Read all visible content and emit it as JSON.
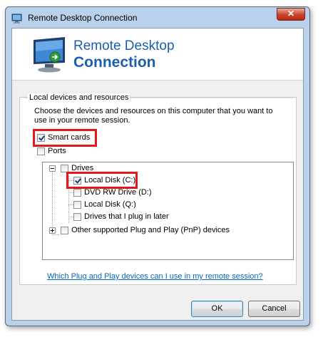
{
  "window": {
    "title": "Remote Desktop Connection",
    "close_label": "✕"
  },
  "banner": {
    "line1": "Remote Desktop",
    "line2": "Connection"
  },
  "group": {
    "title": "Local devices and resources",
    "description": "Choose the devices and resources on this computer that you want to use in your remote session."
  },
  "options": {
    "smart_cards": {
      "label": "Smart cards",
      "checked": true
    },
    "ports": {
      "label": "Ports",
      "checked": false
    }
  },
  "tree": {
    "drives": {
      "label": "Drives",
      "checked": false,
      "expanded": true
    },
    "drive_items": [
      {
        "label": "Local Disk (C:)",
        "checked": true
      },
      {
        "label": "DVD RW Drive (D:)",
        "checked": false
      },
      {
        "label": "Local Disk (Q:)",
        "checked": false
      },
      {
        "label": "Drives that I plug in later",
        "checked": false
      }
    ],
    "pnp": {
      "label": "Other supported Plug and Play (PnP) devices",
      "checked": false,
      "expanded": false
    }
  },
  "help_link": "Which Plug and Play devices can I use in my remote session?",
  "buttons": {
    "ok": "OK",
    "cancel": "Cancel"
  },
  "colors": {
    "accent": "#1b5fab",
    "highlight": "#e3161c",
    "link": "#0066cc"
  },
  "icons": {
    "title": "remote-desktop-icon",
    "banner": "remote-desktop-monitor-icon"
  }
}
